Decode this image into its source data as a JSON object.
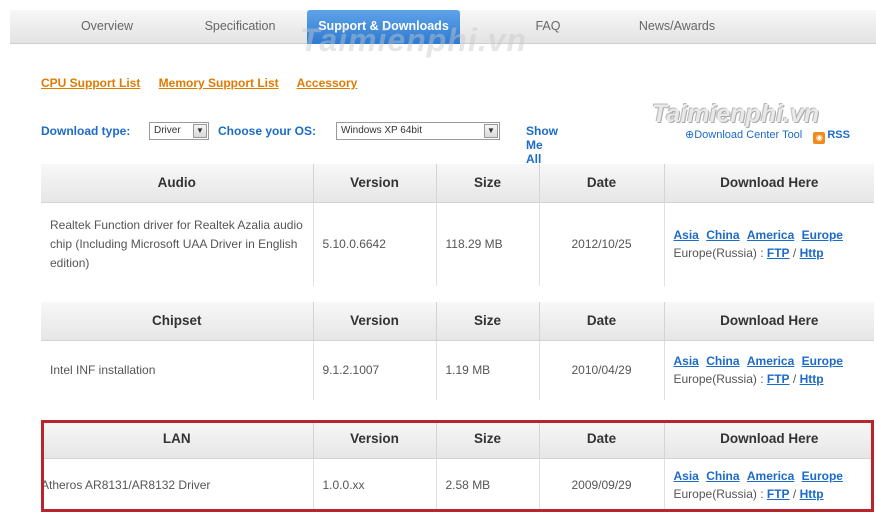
{
  "tabs": [
    {
      "label": "Overview"
    },
    {
      "label": "Specification"
    },
    {
      "label": "Support & Downloads"
    },
    {
      "label": "FAQ"
    },
    {
      "label": "News/Awards"
    }
  ],
  "watermark": "Taimienphi.vn",
  "sublinks": {
    "cpu": "CPU Support List",
    "memory": "Memory Support List",
    "accessory": "Accessory"
  },
  "filter": {
    "download_type_label": "Download type:",
    "download_type_value": "Driver",
    "os_label": "Choose your OS:",
    "os_value": "Windows XP 64bit",
    "show_all": "Show Me All"
  },
  "brand": {
    "logo_text": "Taimienphi.vn",
    "download_center": "Download Center Tool",
    "rss": "RSS"
  },
  "columns": {
    "version": "Version",
    "size": "Size",
    "date": "Date",
    "download": "Download Here"
  },
  "download_links": {
    "asia": "Asia",
    "china": "China",
    "america": "America",
    "europe": "Europe",
    "europe_russia": "Europe(Russia) :",
    "ftp": "FTP",
    "sep": "/",
    "http": "Http"
  },
  "sections": [
    {
      "category": "Audio",
      "name": "Realtek Function driver for Realtek Azalia audio chip (Including Microsoft UAA Driver in English edition)",
      "version": "5.10.0.6642",
      "size": "118.29 MB",
      "date": "2012/10/25"
    },
    {
      "category": "Chipset",
      "name": "Intel INF installation",
      "version": "9.1.2.1007",
      "size": "1.19 MB",
      "date": "2010/04/29"
    },
    {
      "category": "LAN",
      "name": "Atheros AR8131/AR8132 Driver",
      "version": "1.0.0.xx",
      "size": "2.58 MB",
      "date": "2009/09/29"
    }
  ],
  "colors": {
    "accent_blue": "#1c6bc8",
    "orange_link": "#e07b00",
    "highlight_red": "#b8262b",
    "active_tab": "#2d7ad2"
  }
}
